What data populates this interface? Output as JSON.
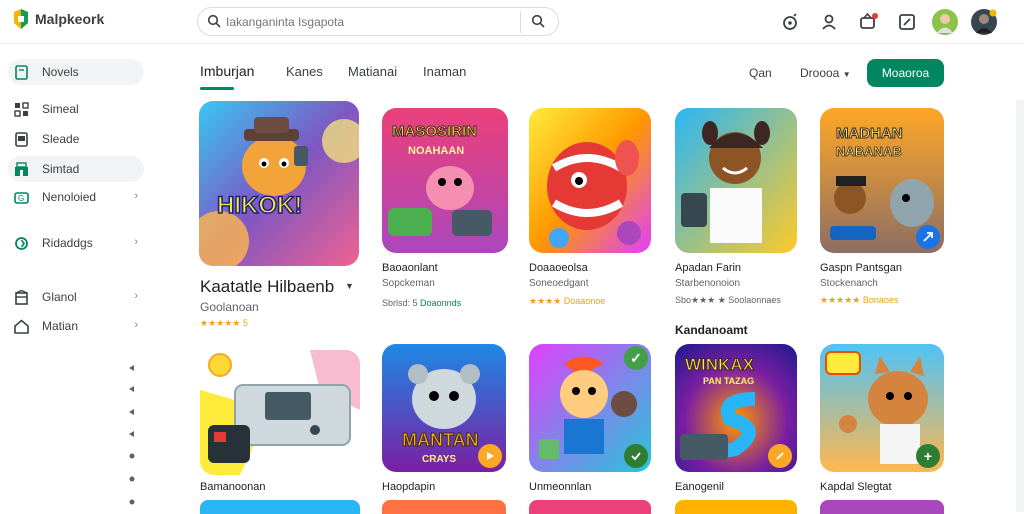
{
  "app": {
    "name": "Malpkeork"
  },
  "search": {
    "placeholder": "Iakanganinta Isgapota"
  },
  "sidebar": {
    "items": [
      {
        "label": "Novels",
        "icon": "book-icon"
      },
      {
        "label": "Simeal",
        "icon": "grid-icon"
      },
      {
        "label": "Sleade",
        "icon": "tablet-icon"
      },
      {
        "label": "Simtad",
        "icon": "store-icon"
      },
      {
        "label": "Nenoloied",
        "icon": "gamepad-icon"
      },
      {
        "label": "Ridaddgs",
        "icon": "refresh-icon"
      },
      {
        "label": "Glanol",
        "icon": "building-icon"
      },
      {
        "label": "Matian",
        "icon": "home-icon"
      }
    ]
  },
  "tabs": [
    "Imburjan",
    "Kanes",
    "Matianai",
    "Inaman"
  ],
  "controls": {
    "sort_label": "Qan",
    "filter_label": "Droooa",
    "cta_label": "Moaoroa"
  },
  "colors": {
    "accent": "#01875f",
    "star": "#e8a317"
  },
  "apps": [
    {
      "name": "Kaatatle Hilbaenb",
      "sub": "Goolanoan",
      "rating": "★★★★★ 5"
    },
    {
      "name": "Baoaonlant",
      "sub": "Sopckeman",
      "rating": "Sbrlsd: 5",
      "extra": "Doaonnds"
    },
    {
      "name": "Doaaoeolsa",
      "sub": "Soneoedgant",
      "rating": "★★★★ Doaaonoe"
    },
    {
      "name": "Apadan Farin",
      "sub": "Starbenonoion",
      "rating": "Sbo★★★ ★ Soolaonnaes"
    },
    {
      "name": "Gaspn Pantsgan",
      "sub": "Stockenanch",
      "rating": "★★★★★ Bonaoes"
    },
    {
      "name": "Bamanoonan"
    },
    {
      "name": "Haopdapin"
    },
    {
      "name": "Unmeonnlan"
    },
    {
      "name": "Eanogenil"
    },
    {
      "name": "Kapdal Slegtat"
    }
  ],
  "section2_title": "Kandanoamt",
  "art_text": {
    "hero": "HIKOK!",
    "poster1_line1": "MASOSIRIN",
    "poster1_line2": "NOAHAAN",
    "poster2_line1": "MADHAN",
    "poster2_line2": "NABANAB",
    "poster3": "MANTAN",
    "poster3_sub": "CRAYS",
    "poster4_line1": "WINKAX",
    "poster4_line2": "PAN TAZAG"
  }
}
